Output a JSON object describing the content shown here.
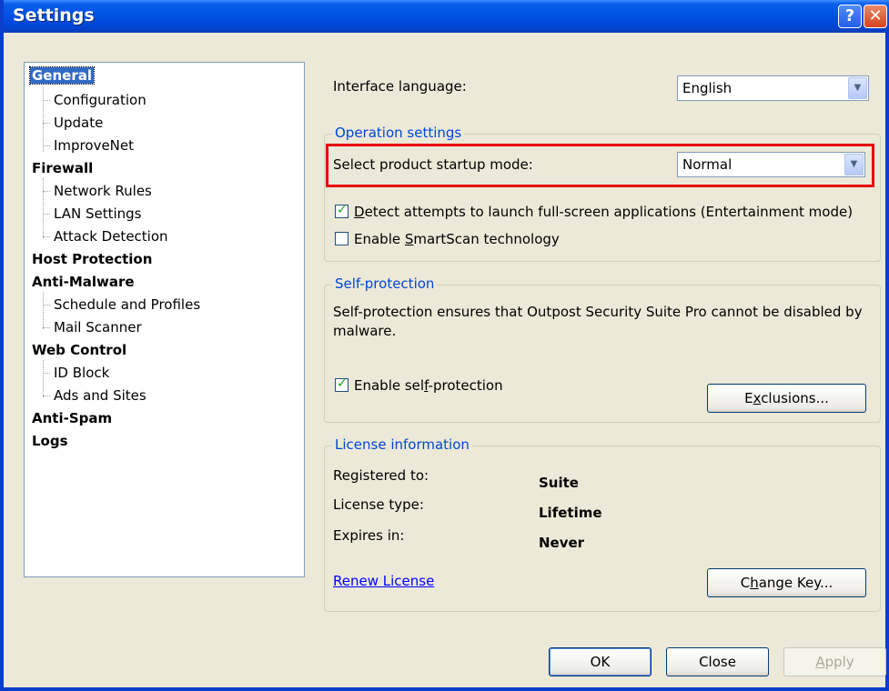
{
  "window": {
    "title": "Settings"
  },
  "titlebar": {
    "help_label": "?",
    "close_label": "✕"
  },
  "tree": {
    "general": "General",
    "configuration": "Configuration",
    "update": "Update",
    "improvenet": "ImproveNet",
    "firewall": "Firewall",
    "network_rules": "Network Rules",
    "lan_settings": "LAN Settings",
    "attack_detection": "Attack Detection",
    "host_protection": "Host Protection",
    "anti_malware": "Anti-Malware",
    "schedule_profiles": "Schedule and Profiles",
    "mail_scanner": "Mail Scanner",
    "web_control": "Web Control",
    "id_block": "ID Block",
    "ads_sites": "Ads and Sites",
    "anti_spam": "Anti-Spam",
    "logs": "Logs"
  },
  "interface_language": {
    "label": "Interface language:",
    "value": "English"
  },
  "operation": {
    "title": "Operation settings",
    "startup_label": "Select product startup mode:",
    "startup_value": "Normal",
    "entertainment_pre": "D",
    "entertainment_rest": "etect attempts to launch full-screen applications (Entertainment mode)",
    "entertainment_checked": true,
    "smartscan_pre": "Enable ",
    "smartscan_u": "S",
    "smartscan_rest": "martScan technology",
    "smartscan_checked": false
  },
  "self_protection": {
    "title": "Self-protection",
    "description": "Self-protection ensures that Outpost Security Suite Pro cannot be disabled by malware.",
    "enable_pre": "Enable sel",
    "enable_u": "f",
    "enable_rest": "-protection",
    "enable_checked": true,
    "exclusions_pre": "E",
    "exclusions_u": "x",
    "exclusions_rest": "clusions..."
  },
  "license": {
    "title": "License information",
    "registered_label": "Registered to:",
    "registered_value": "Suite",
    "type_label": "License type:",
    "type_value": "Lifetime",
    "expires_label": "Expires in:",
    "expires_value": "Never",
    "renew_link": "Renew License",
    "change_key_pre": "C",
    "change_key_u": "h",
    "change_key_rest": "ange Key..."
  },
  "footer": {
    "ok": "OK",
    "close": "Close",
    "apply_u": "A",
    "apply_rest": "pply"
  },
  "icons": {
    "combo_arrow": "chevron-down-icon",
    "check": "checkmark-icon"
  }
}
